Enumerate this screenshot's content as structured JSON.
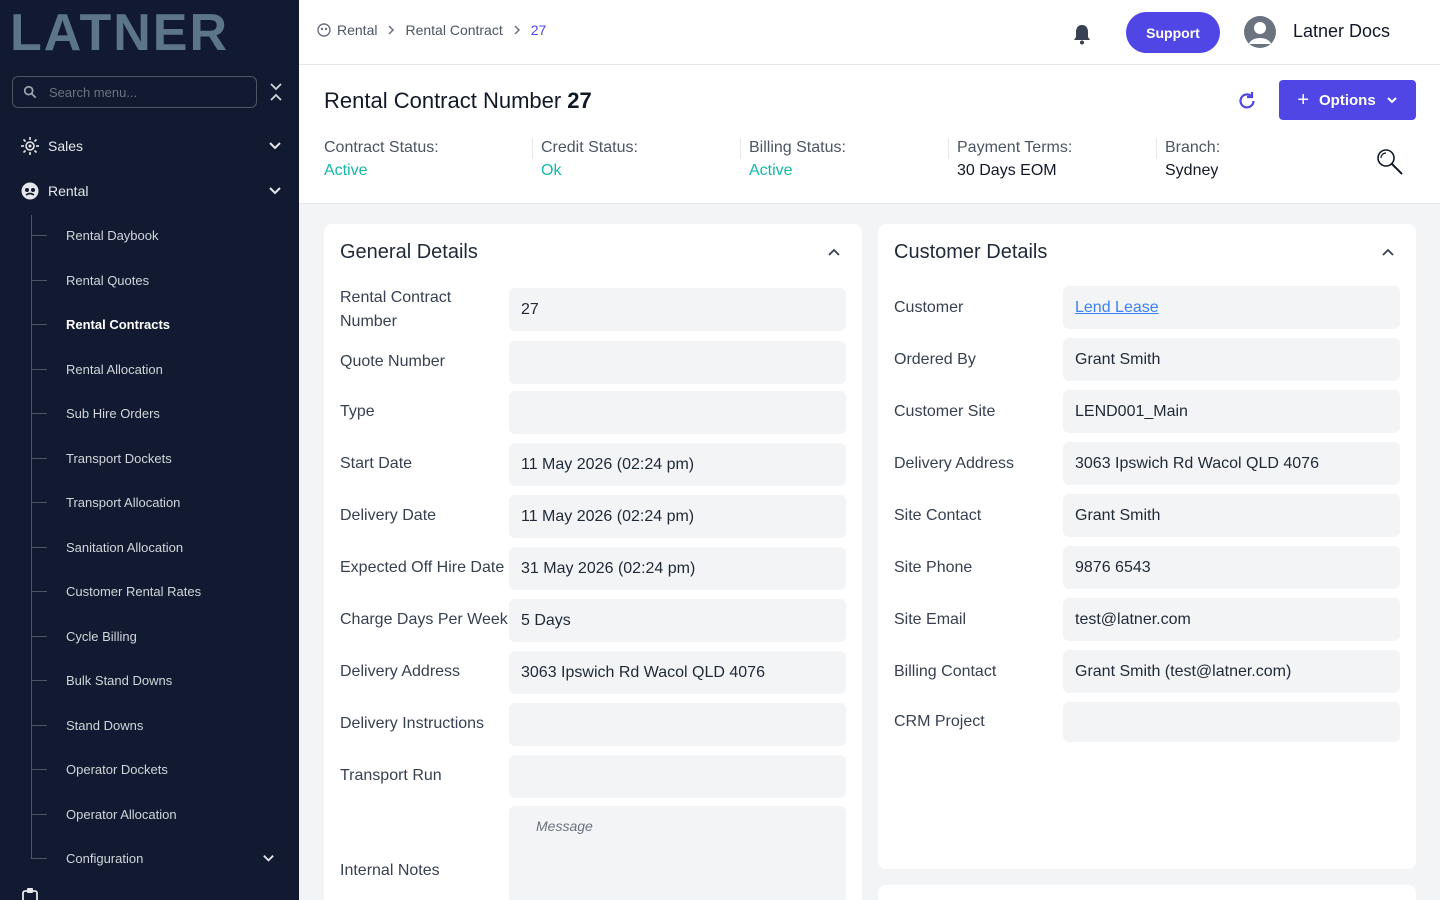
{
  "colors": {
    "sidebar_bg": "#111a30",
    "accent": "#4f46e5",
    "status_green": "#14b8a6",
    "link": "#3b82f6"
  },
  "sidebar": {
    "logo_text": "LATNER",
    "search_placeholder": "Search menu...",
    "sales_label": "Sales",
    "rental_label": "Rental",
    "items": [
      {
        "label": "Rental Daybook"
      },
      {
        "label": "Rental Quotes"
      },
      {
        "label": "Rental Contracts",
        "active": true
      },
      {
        "label": "Rental Allocation"
      },
      {
        "label": "Sub Hire Orders"
      },
      {
        "label": "Transport Dockets"
      },
      {
        "label": "Transport Allocation"
      },
      {
        "label": "Sanitation Allocation"
      },
      {
        "label": "Customer Rental Rates"
      },
      {
        "label": "Cycle Billing"
      },
      {
        "label": "Bulk Stand Downs"
      },
      {
        "label": "Stand Downs"
      },
      {
        "label": "Operator Dockets"
      },
      {
        "label": "Operator Allocation"
      },
      {
        "label": "Configuration"
      }
    ]
  },
  "topbar": {
    "breadcrumb": [
      "Rental",
      "Rental Contract",
      "27"
    ],
    "support_label": "Support",
    "user_name": "Latner Docs"
  },
  "header": {
    "title": "Rental Contract Number",
    "number": "27",
    "options_label": "Options",
    "statuses": [
      {
        "label": "Contract Status:",
        "value": "Active",
        "tone": "green"
      },
      {
        "label": "Credit Status:",
        "value": "Ok",
        "tone": "green"
      },
      {
        "label": "Billing Status:",
        "value": "Active",
        "tone": "green"
      },
      {
        "label": "Payment Terms:",
        "value": "30 Days EOM",
        "tone": "dark"
      },
      {
        "label": "Branch:",
        "value": "Sydney",
        "tone": "dark"
      }
    ]
  },
  "general": {
    "title": "General Details",
    "rows": [
      {
        "label": "Rental Contract Number",
        "value": "27"
      },
      {
        "label": "Quote Number",
        "value": ""
      },
      {
        "label": "Type",
        "value": ""
      },
      {
        "label": "Start Date",
        "value": "11 May 2026 (02:24 pm)"
      },
      {
        "label": "Delivery Date",
        "value": "11 May 2026 (02:24 pm)"
      },
      {
        "label": "Expected Off Hire Date",
        "value": "31 May 2026 (02:24 pm)"
      },
      {
        "label": "Charge Days Per Week",
        "value": "5 Days"
      },
      {
        "label": "Delivery Address",
        "value": "3063 Ipswich Rd Wacol QLD 4076"
      },
      {
        "label": "Delivery Instructions",
        "value": ""
      },
      {
        "label": "Transport Run",
        "value": ""
      }
    ],
    "notes_label": "Internal Notes",
    "notes_placeholder": "Message"
  },
  "customer": {
    "title": "Customer Details",
    "rows": [
      {
        "label": "Customer",
        "value": "Lend Lease",
        "link": true
      },
      {
        "label": "Ordered By",
        "value": "Grant Smith"
      },
      {
        "label": "Customer Site",
        "value": "LEND001_Main"
      },
      {
        "label": "Delivery Address",
        "value": "3063 Ipswich Rd Wacol QLD 4076"
      },
      {
        "label": "Site Contact",
        "value": "Grant Smith"
      },
      {
        "label": "Site Phone",
        "value": "9876 6543"
      },
      {
        "label": "Site Email",
        "value": "test@latner.com"
      },
      {
        "label": "Billing Contact",
        "value": "Grant Smith (test@latner.com)"
      },
      {
        "label": "CRM Project",
        "value": ""
      }
    ]
  }
}
